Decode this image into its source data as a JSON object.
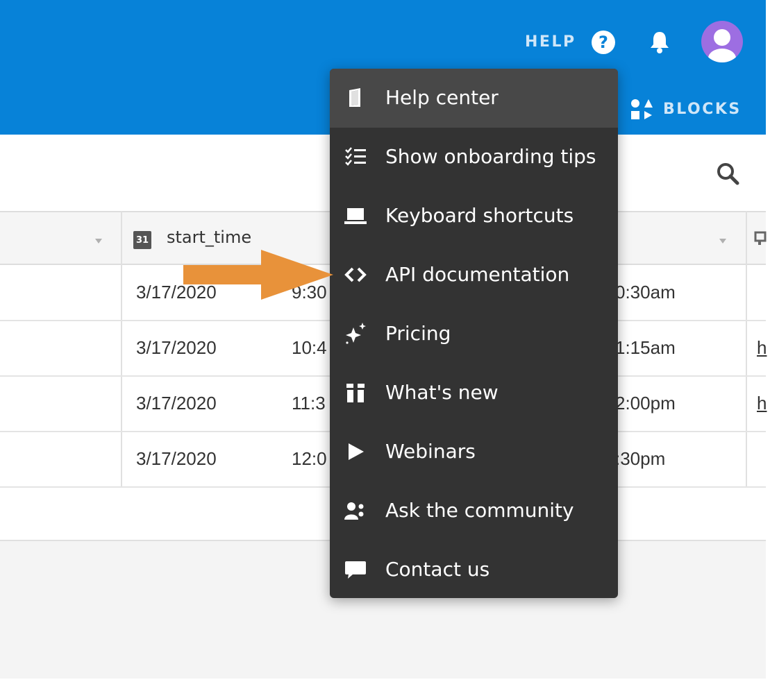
{
  "header": {
    "help_label": "HELP",
    "help_glyph": "?",
    "blocks_label": "BLOCKS"
  },
  "grid": {
    "column_header": "start_time",
    "calendar_glyph": "31",
    "rows": [
      {
        "date": "3/17/2020",
        "time": "9:30",
        "end": "0:30am",
        "link": ""
      },
      {
        "date": "3/17/2020",
        "time": "10:4",
        "end": "1:15am",
        "link": "h"
      },
      {
        "date": "3/17/2020",
        "time": "11:3",
        "end": "2:00pm",
        "link": "h"
      },
      {
        "date": "3/17/2020",
        "time": "12:0",
        "end": ":30pm",
        "link": ""
      }
    ]
  },
  "help_menu": {
    "items": [
      {
        "label": "Help center",
        "icon": "book-icon"
      },
      {
        "label": "Show onboarding tips",
        "icon": "checklist-icon"
      },
      {
        "label": "Keyboard shortcuts",
        "icon": "laptop-icon"
      },
      {
        "label": "API documentation",
        "icon": "code-icon"
      },
      {
        "label": "Pricing",
        "icon": "sparkle-icon"
      },
      {
        "label": "What's new",
        "icon": "gift-icon"
      },
      {
        "label": "Webinars",
        "icon": "play-icon"
      },
      {
        "label": "Ask the community",
        "icon": "users-icon"
      },
      {
        "label": "Contact us",
        "icon": "chat-bubble-icon"
      }
    ]
  },
  "colors": {
    "header_blue": "#0782d8",
    "menu_bg": "#333333",
    "menu_hover": "#484848",
    "annotation_arrow": "#e8923a",
    "avatar": "#9d6ee2"
  }
}
